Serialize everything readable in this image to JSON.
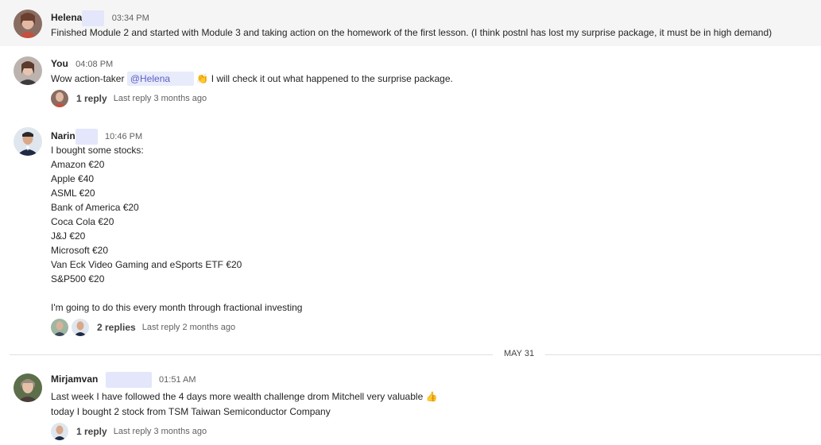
{
  "messages": [
    {
      "author": "Helena",
      "time": "03:34 PM",
      "lines": [
        "Finished Module 2 and started with Module 3 and taking action on the homework of the first lesson. (I think postnl has lost my surprise package, it must be in high demand)"
      ]
    },
    {
      "author": "You",
      "time": "04:08 PM",
      "text_before": "Wow action-taker",
      "mention": "@Helena",
      "emoji": "👏",
      "text_after": "I will check it out what happened to the surprise package.",
      "replies": "1 reply",
      "last_reply": "Last reply 3 months ago"
    },
    {
      "author": "Narin",
      "time": "10:46 PM",
      "lines": [
        "I bought some stocks:",
        "Amazon €20",
        "Apple €40",
        "ASML €20",
        "Bank of America €20",
        "Coca Cola €20",
        "J&J €20",
        "Microsoft €20",
        "Van Eck Video Gaming and eSports ETF €20",
        "S&P500 €20",
        "",
        "I'm going to do this every month through fractional investing"
      ],
      "replies": "2 replies",
      "last_reply": "Last reply 2 months ago"
    },
    {
      "author": "Mirjamvan",
      "time": "01:51 AM",
      "line1": "Last week I have followed the 4 days more wealth challenge drom Mitchell very valuable",
      "emoji": "👍",
      "line2": "today I bought 2 stock from TSM Taiwan Semiconductor Company",
      "replies": "1 reply",
      "last_reply": "Last reply 3 months ago"
    }
  ],
  "date_divider": "MAY 31",
  "colors": {
    "mention": "#5b5fc7",
    "redaction": "#e4e6fb",
    "highlight_bg": "#f5f5f5"
  }
}
